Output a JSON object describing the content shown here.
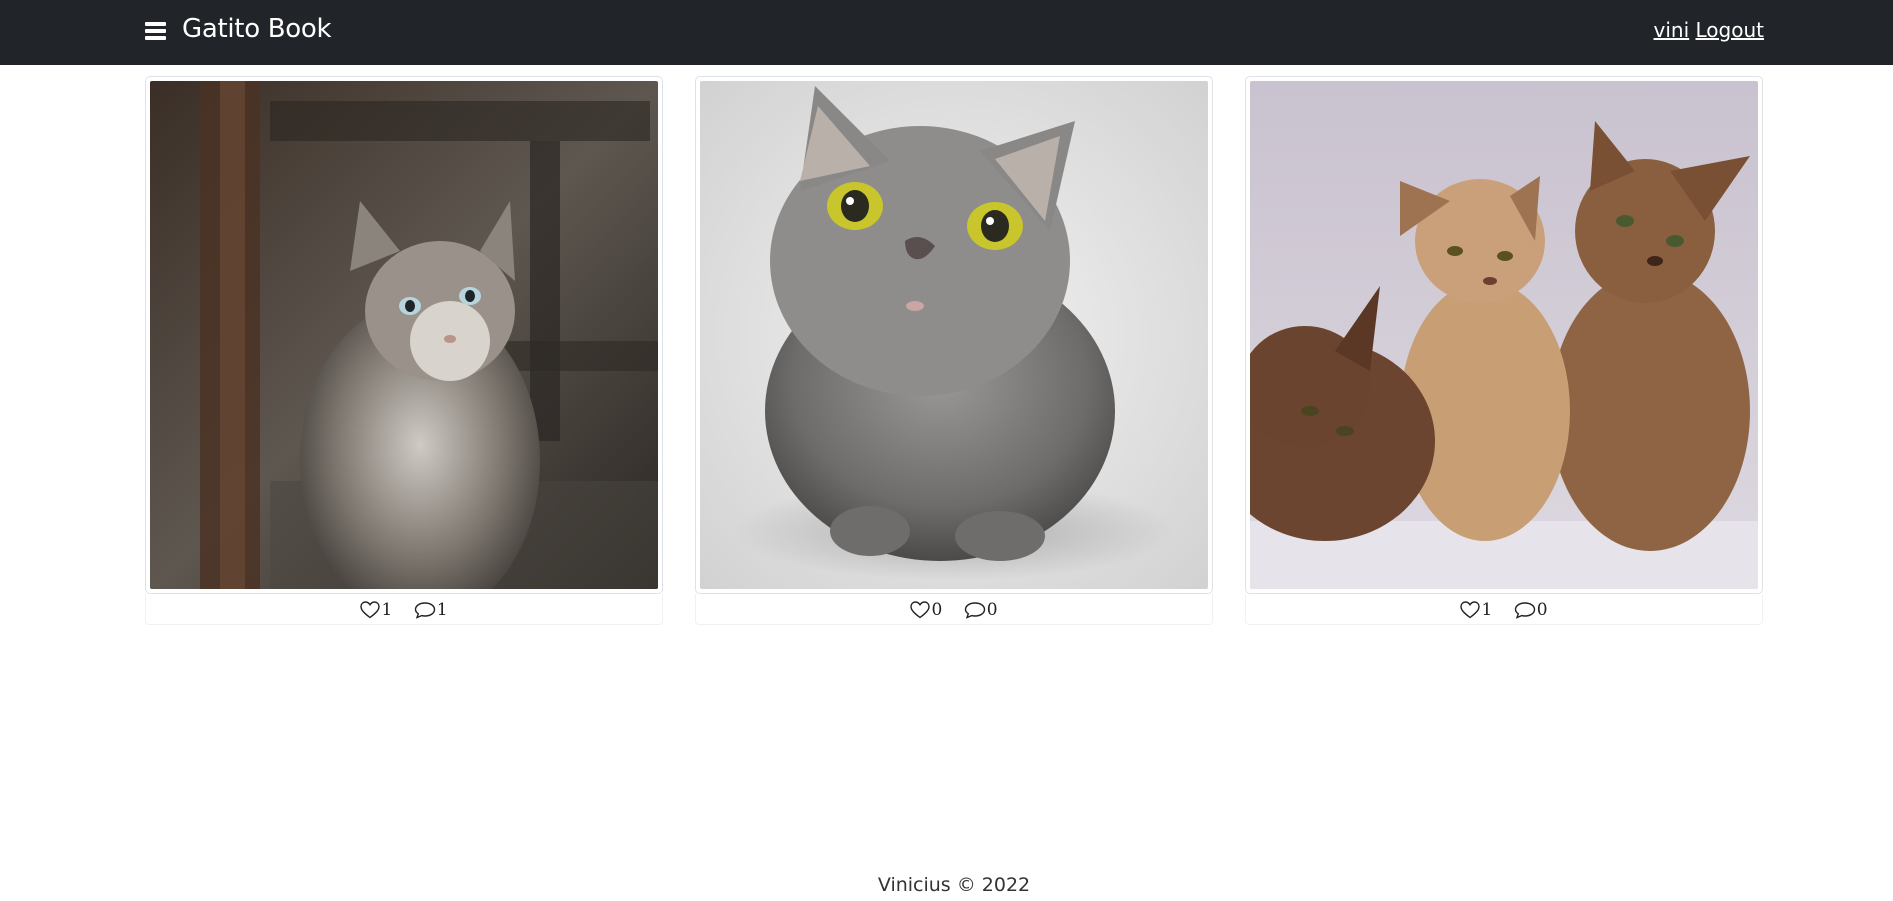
{
  "header": {
    "brand": "Gatito Book",
    "username": "vini",
    "logout_label": "Logout",
    "background_color": "#212529"
  },
  "photos": [
    {
      "description": "kitten",
      "likes": "1",
      "comments": "1"
    },
    {
      "description": "grey cat",
      "likes": "0",
      "comments": "0"
    },
    {
      "description": "brown kittens",
      "likes": "1",
      "comments": "0"
    }
  ],
  "footer": {
    "text": "Vinicius © 2022"
  },
  "icons": {
    "menu": "hamburger-icon",
    "like": "heart-icon",
    "comment": "comment-icon"
  }
}
